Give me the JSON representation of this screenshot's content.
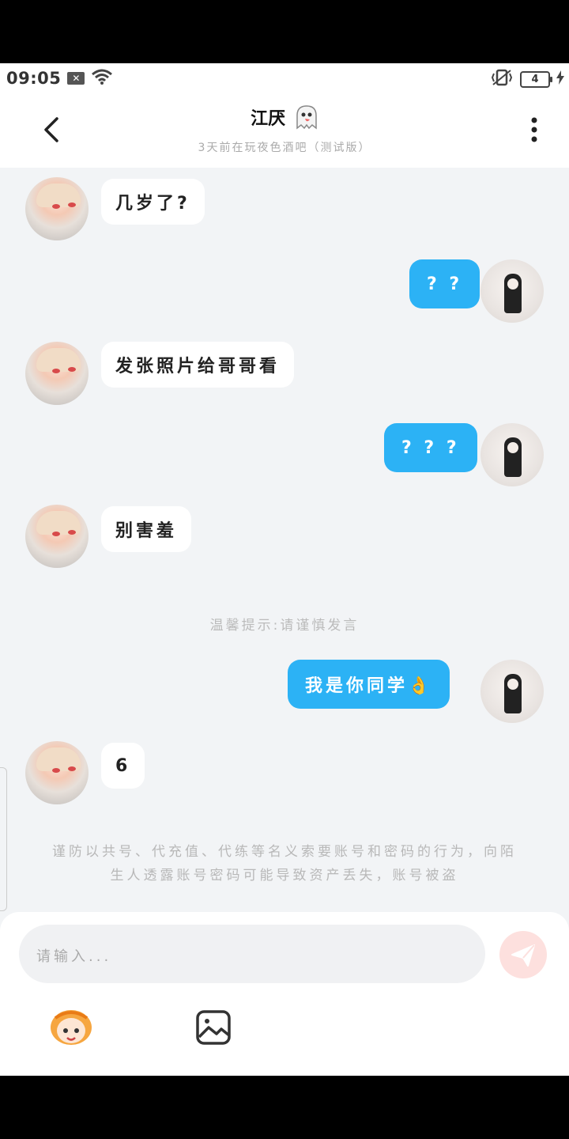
{
  "status_bar": {
    "time": "09:05",
    "battery": "4"
  },
  "header": {
    "title": "江厌",
    "subtitle": "3天前在玩夜色酒吧（测试版）"
  },
  "messages": [
    {
      "side": "in",
      "text": "几岁了?"
    },
    {
      "side": "out",
      "text": "? ?"
    },
    {
      "side": "in",
      "text": "发张照片给哥哥看"
    },
    {
      "side": "out",
      "text": "? ? ?"
    },
    {
      "side": "in",
      "text": "别害羞"
    },
    {
      "side": "out",
      "text": "我是你同学👌"
    },
    {
      "side": "in",
      "text": "6"
    }
  ],
  "system_hint": "温馨提示:请谨慎发言",
  "notice": "谨防以共号、代充值、代练等名义索要账号和密码的行为，向陌生人透露账号密码可能导致资产丢失，账号被盗",
  "composer": {
    "placeholder": "请输入..."
  },
  "icons": {
    "back": "chevron-left-icon",
    "more": "more-vertical-icon",
    "send": "send-icon",
    "emoji": "emoji-avatar-icon",
    "image": "image-icon",
    "wifi": "wifi-icon",
    "vibrate": "vibrate-icon"
  }
}
